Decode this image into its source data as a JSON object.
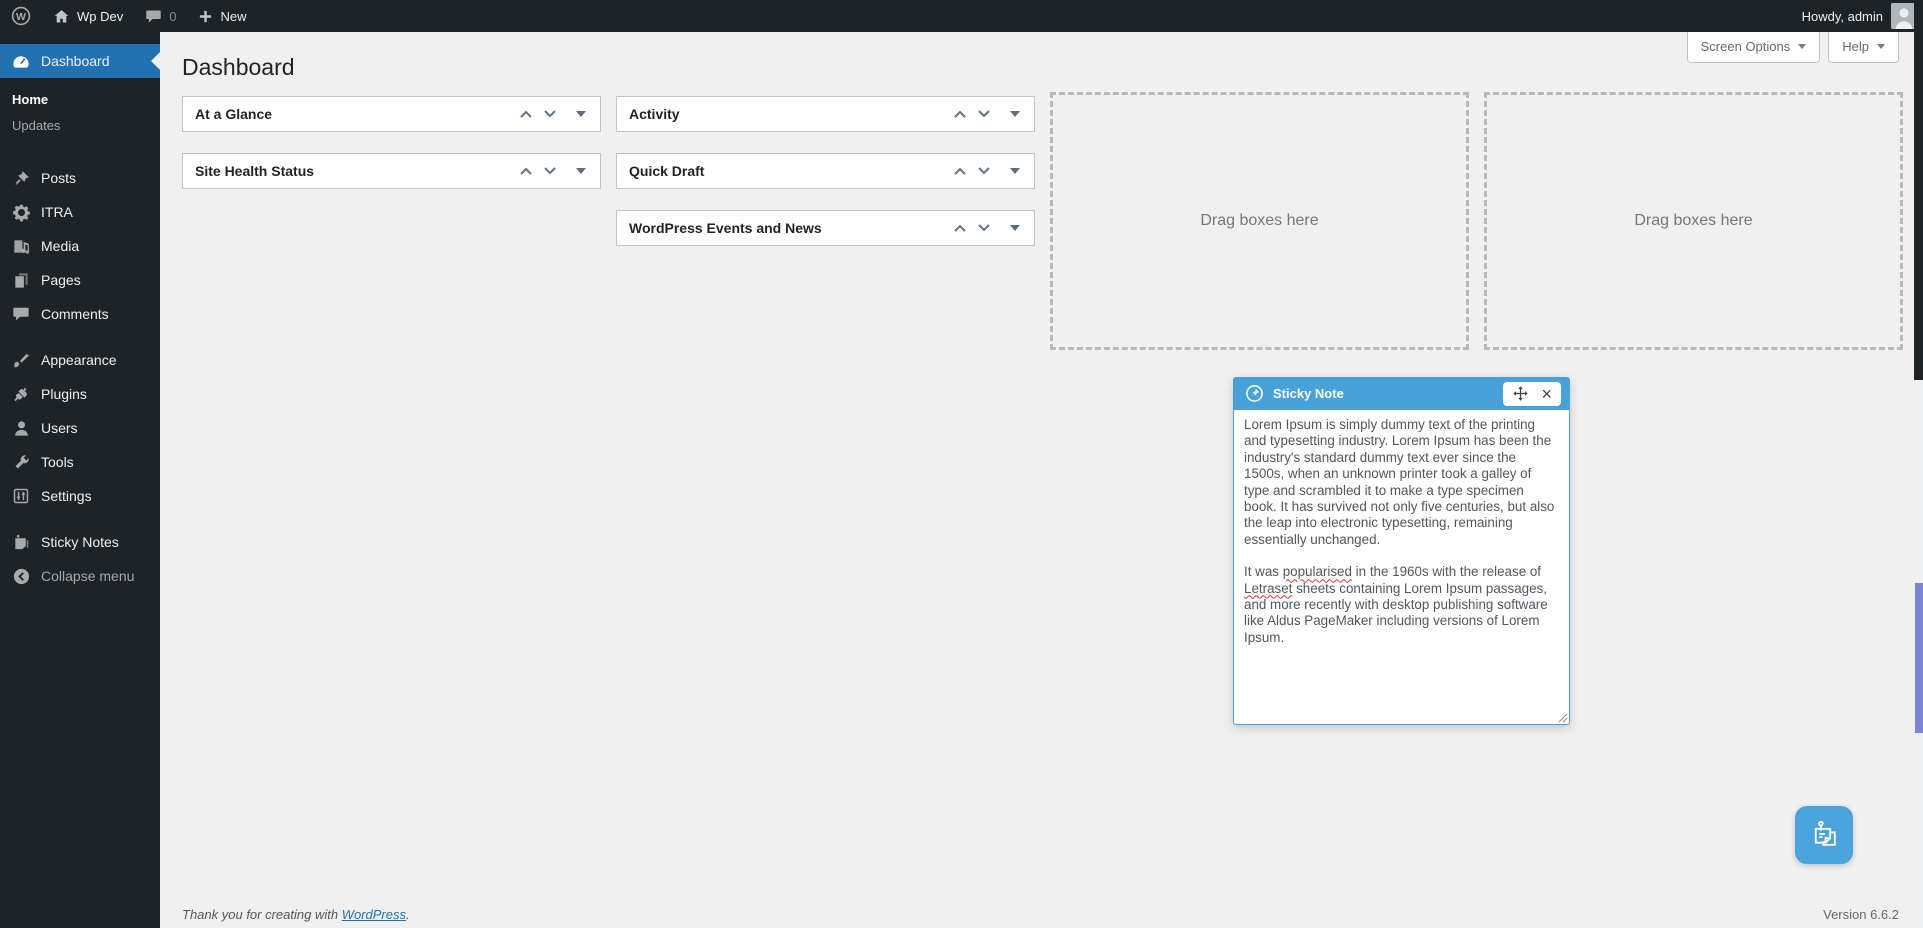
{
  "admin_bar": {
    "site_name": "Wp Dev",
    "comments_count": "0",
    "new_label": "New",
    "howdy": "Howdy, admin"
  },
  "screen_meta": {
    "screen_options": "Screen Options",
    "help": "Help"
  },
  "page": {
    "title": "Dashboard"
  },
  "sidebar": {
    "dashboard": "Dashboard",
    "home": "Home",
    "updates": "Updates",
    "posts": "Posts",
    "itra": "ITRA",
    "media": "Media",
    "pages": "Pages",
    "comments": "Comments",
    "appearance": "Appearance",
    "plugins": "Plugins",
    "users": "Users",
    "tools": "Tools",
    "settings": "Settings",
    "sticky_notes": "Sticky Notes",
    "collapse": "Collapse menu"
  },
  "widgets": {
    "at_a_glance": "At a Glance",
    "site_health": "Site Health Status",
    "activity": "Activity",
    "quick_draft": "Quick Draft",
    "events": "WordPress Events and News",
    "drop_zone": "Drag boxes here"
  },
  "sticky_note": {
    "title": "Sticky Note",
    "p1": "Lorem Ipsum is simply dummy text of the printing and typesetting industry. Lorem Ipsum has been the industry's standard dummy text ever since the 1500s, when an unknown printer took a galley of type and scrambled it to make a type specimen book. It has survived not only five centuries, but also the leap into electronic typesetting, remaining essentially unchanged.",
    "p2_before": "It was ",
    "p2_misspelled1": "popularised",
    "p2_mid": " in the 1960s with the release of ",
    "p2_misspelled2": "Letraset",
    "p2_after": " sheets containing Lorem Ipsum passages, and more recently with desktop publishing software like Aldus PageMaker including versions of Lorem Ipsum."
  },
  "footer": {
    "thanks_prefix": "Thank you for creating with ",
    "wordpress_link": "WordPress",
    "thanks_suffix": ".",
    "version": "Version 6.6.2"
  },
  "colors": {
    "admin_bar_bg": "#1d2327",
    "menu_active_blue": "#2271b1",
    "content_bg": "#f0f0f1",
    "note_blue": "#49a1da",
    "fab_blue": "#4aa3dc",
    "link_blue": "#2271b1"
  }
}
